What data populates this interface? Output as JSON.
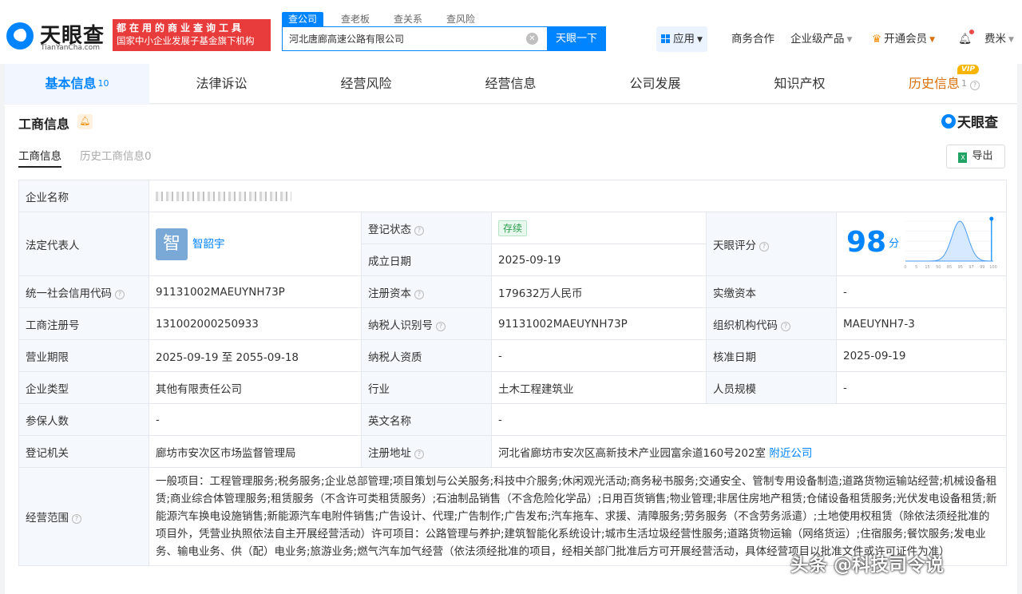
{
  "header": {
    "logo": {
      "name": "天眼查",
      "domain": "TianYanCha.com"
    },
    "slogan": {
      "line1": "都在用的商业查询工具",
      "line2": "国家中小企业发展子基金旗下机构"
    },
    "search_tabs": [
      "查公司",
      "查老板",
      "查关系",
      "查风险"
    ],
    "search_value": "河北唐廊高速公路有限公司",
    "search_button": "天眼一下",
    "nav": {
      "apps": "应用",
      "biz": "商务合作",
      "enterprise": "企业级产品",
      "vip": "开通会员",
      "user": "费米"
    }
  },
  "tabs": [
    {
      "label": "基本信息",
      "count": "10"
    },
    {
      "label": "法律诉讼"
    },
    {
      "label": "经营风险"
    },
    {
      "label": "经营信息"
    },
    {
      "label": "公司发展"
    },
    {
      "label": "知识产权"
    },
    {
      "label": "历史信息",
      "count": "1",
      "badge": "VIP"
    }
  ],
  "section": {
    "title": "工商信息",
    "brand": "天眼查",
    "subtabs": [
      "工商信息",
      "历史工商信息0"
    ],
    "export": "导出"
  },
  "info": {
    "company_name_label": "企业名称",
    "legal_rep_label": "法定代表人",
    "legal_rep_avatar": "智",
    "legal_rep_name": "智韶宇",
    "reg_status_label": "登记状态",
    "reg_status": "存续",
    "found_date_label": "成立日期",
    "found_date": "2025-09-19",
    "score_label": "天眼评分",
    "score": "98",
    "score_unit": "分",
    "score_axis": [
      "0",
      "5",
      "15",
      "50",
      "85",
      "95",
      "97",
      "99",
      "100"
    ],
    "credit_code_label": "统一社会信用代码",
    "credit_code": "91131002MAEUYNH73P",
    "reg_capital_label": "注册资本",
    "reg_capital": "179632万人民币",
    "paid_capital_label": "实缴资本",
    "paid_capital": "-",
    "reg_no_label": "工商注册号",
    "reg_no": "131002000250933",
    "tax_id_label": "纳税人识别号",
    "tax_id": "91131002MAEUYNH73P",
    "org_code_label": "组织机构代码",
    "org_code": "MAEUYNH7-3",
    "term_label": "营业期限",
    "term": "2025-09-19 至 2055-09-18",
    "tax_qual_label": "纳税人资质",
    "tax_qual": "-",
    "approve_label": "核准日期",
    "approve": "2025-09-19",
    "type_label": "企业类型",
    "type": "其他有限责任公司",
    "industry_label": "行业",
    "industry": "土木工程建筑业",
    "staff_label": "人员规模",
    "staff": "-",
    "insured_label": "参保人数",
    "insured": "-",
    "en_name_label": "英文名称",
    "en_name": "-",
    "authority_label": "登记机关",
    "authority": "廊坊市安次区市场监督管理局",
    "address_label": "注册地址",
    "address": "河北省廊坊市安次区高新技术产业园富余道160号202室",
    "nearby": "附近公司",
    "scope_label": "经营范围",
    "scope": "一般项目：工程管理服务;税务服务;企业总部管理;项目策划与公关服务;科技中介服务;休闲观光活动;商务秘书服务;交通安全、管制专用设备制造;道路货物运输站经营;机械设备租赁;商业综合体管理服务;租赁服务（不含许可类租赁服务）;石油制品销售（不含危险化学品）;日用百货销售;物业管理;非居住房地产租赁;仓储设备租赁服务;光伏发电设备租赁;新能源汽车换电设施销售;新能源汽车电附件销售;广告设计、代理;广告制作;广告发布;汽车拖车、求援、清障服务;劳务服务（不含劳务派遣）;土地使用权租赁（除依法须经批准的项目外，凭营业执照依法自主开展经营活动）许可项目：公路管理与养护;建筑智能化系统设计;城市生活垃圾经营性服务;道路货物运输（网络货运）;住宿服务;餐饮服务;发电业务、输电业务、供（配）电业务;旅游业务;燃气汽车加气经营（依法须经批准的项目，经相关部门批准后方可开展经营活动，具体经营项目以批准文件或许可证件为准）"
  },
  "watermark": "头条 @科技司令说"
}
